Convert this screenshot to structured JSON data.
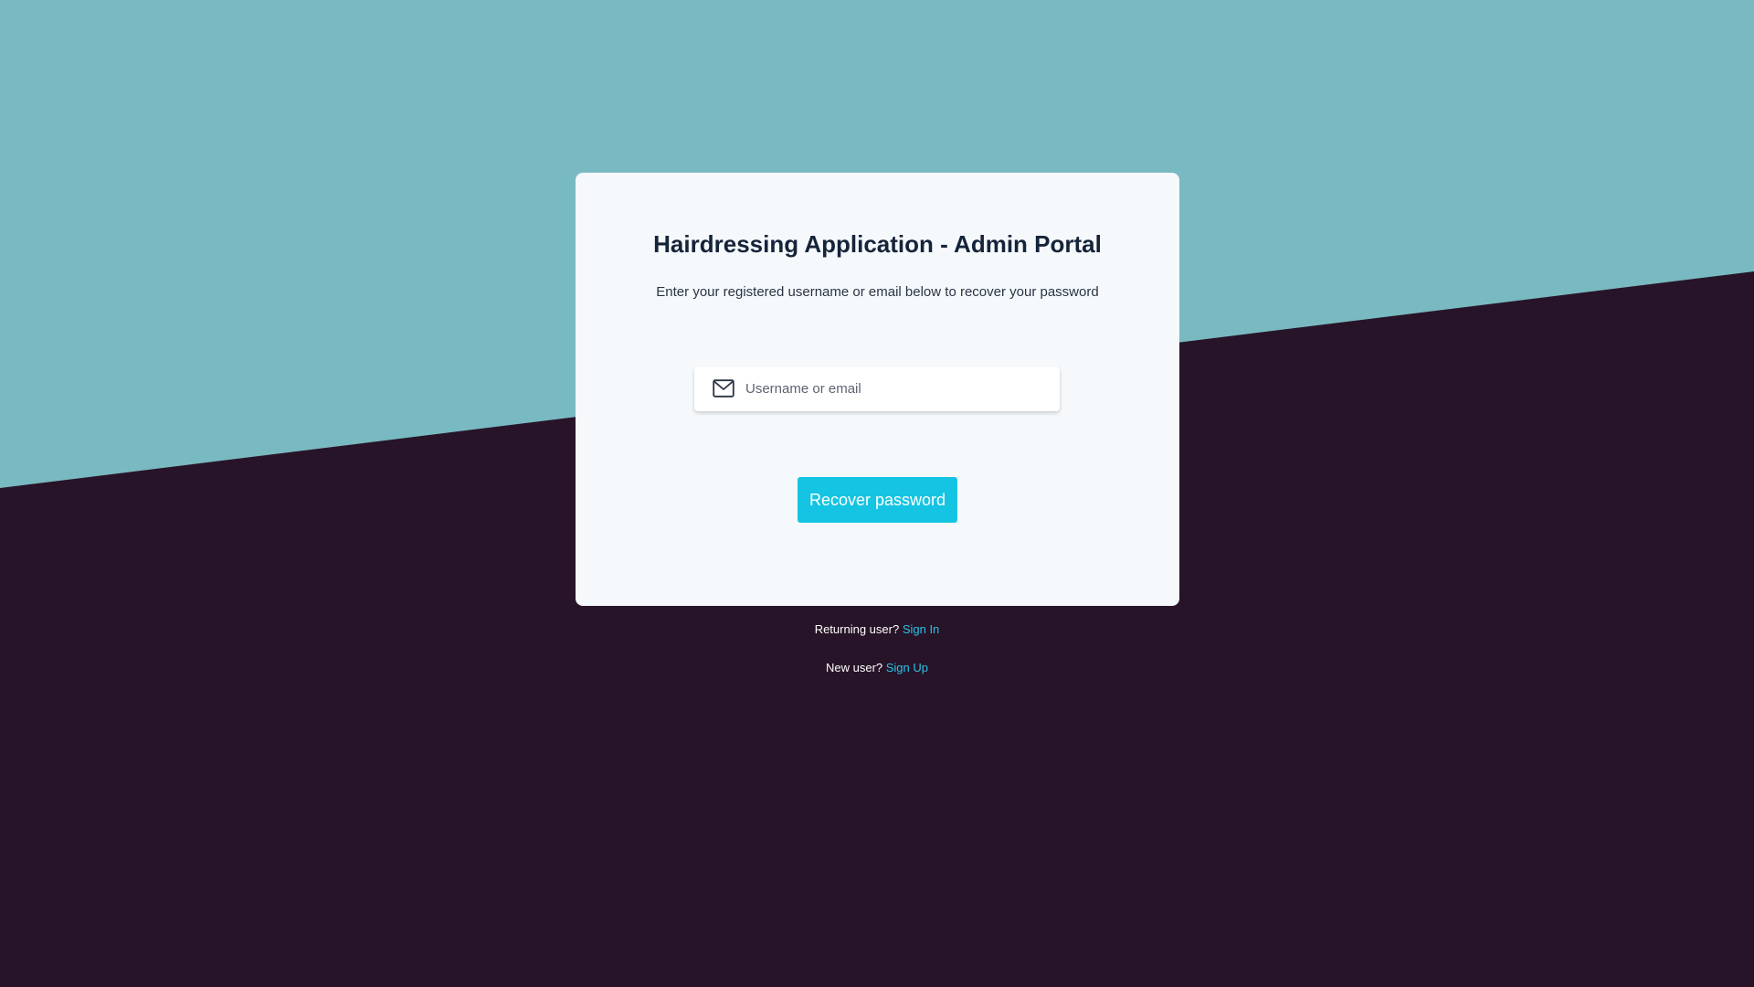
{
  "colors": {
    "teal_background": "#79b9c1",
    "dark_background": "#281428",
    "card_background": "#f5f9fc",
    "accent": "#15c4e2",
    "title": "#16243a"
  },
  "card": {
    "title": "Hairdressing Application - Admin Portal",
    "subtitle": "Enter your registered username or email below to recover your password",
    "username_field": {
      "icon": "mail-icon",
      "placeholder": "Username or email",
      "value": ""
    },
    "recover_button_label": "Recover password"
  },
  "footer": {
    "returning_prompt": "Returning user?",
    "sign_in_label": "Sign In",
    "new_prompt": "New user?",
    "sign_up_label": "Sign Up"
  }
}
